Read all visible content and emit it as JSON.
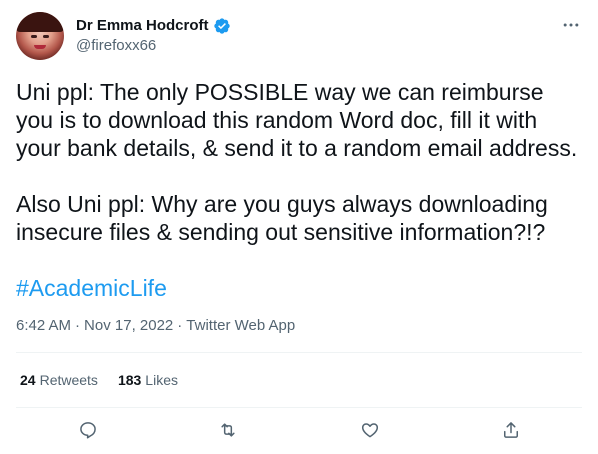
{
  "author": {
    "display_name": "Dr Emma Hodcroft",
    "handle": "@firefoxx66",
    "verified": true
  },
  "tweet": {
    "paragraph1": "Uni ppl: The only POSSIBLE way we can reimburse you is to download this random Word doc, fill it with your bank details, & send it to a random email address.",
    "paragraph2": "Also Uni ppl: Why are you guys always downloading insecure files & sending out sensitive information?!?",
    "hashtag": "#AcademicLife"
  },
  "meta": {
    "time": "6:42 AM",
    "separator": "·",
    "date": "Nov 17, 2022",
    "separator2": "·",
    "source": "Twitter Web App"
  },
  "stats": {
    "retweets_count": "24",
    "retweets_label": "Retweets",
    "likes_count": "183",
    "likes_label": "Likes"
  },
  "icons": {
    "more": "more-horizontal-icon",
    "verified": "verified-badge-icon",
    "reply": "reply-icon",
    "retweet": "retweet-icon",
    "like": "heart-icon",
    "share": "share-icon"
  },
  "colors": {
    "accent": "#1d9bf0",
    "text": "#0f1419",
    "secondary": "#536471",
    "divider": "#eff3f4"
  }
}
